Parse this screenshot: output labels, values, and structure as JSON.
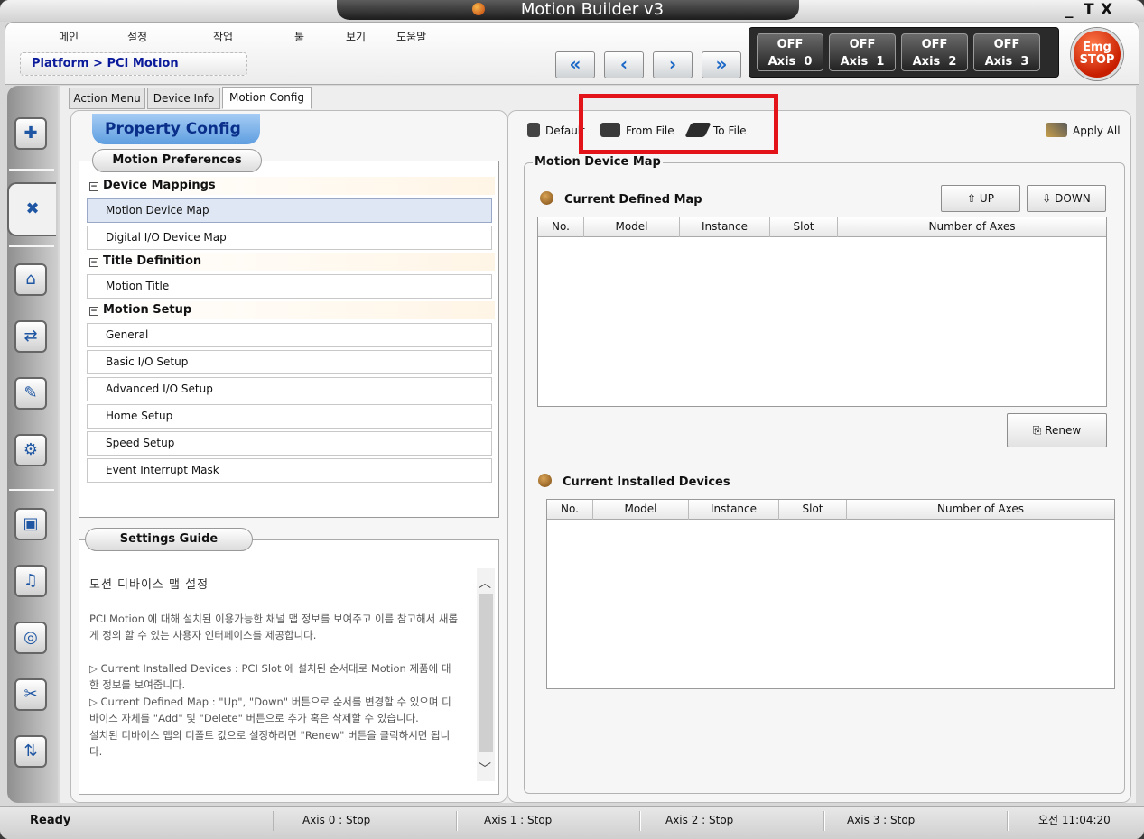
{
  "window": {
    "title": "Motion Builder v3",
    "controls": [
      "_",
      "T",
      "X"
    ]
  },
  "menu": [
    "메인",
    "설정",
    "작업",
    "툴",
    "보기",
    "도움말"
  ],
  "breadcrumb": "Platform > PCI Motion",
  "nav": {
    "first": "«",
    "prev": "‹",
    "next": "›",
    "last": "»"
  },
  "axes": [
    {
      "state": "OFF",
      "label": "Axis",
      "num": "0"
    },
    {
      "state": "OFF",
      "label": "Axis",
      "num": "1"
    },
    {
      "state": "OFF",
      "label": "Axis",
      "num": "2"
    },
    {
      "state": "OFF",
      "label": "Axis",
      "num": "3"
    }
  ],
  "emergency": {
    "line1": "Emg",
    "line2": "STOP"
  },
  "tabs": [
    "Action Menu",
    "Device Info",
    "Motion Config"
  ],
  "left": {
    "header": "Property Config",
    "prefs_title": "Motion Preferences",
    "sections": [
      {
        "title": "Device Mappings",
        "items": [
          "Motion Device Map",
          "Digital I/O Device Map"
        ]
      },
      {
        "title": "Title Definition",
        "items": [
          "Motion Title"
        ]
      },
      {
        "title": "Motion Setup",
        "items": [
          "General",
          "Basic I/O Setup",
          "Advanced I/O Setup",
          "Home Setup",
          "Speed Setup",
          "Event Interrupt Mask"
        ]
      }
    ],
    "guide_title": "Settings Guide",
    "guide": {
      "heading": "모션 디바이스 맵 설정",
      "para1": "PCI Motion 에 대해 설치된 이용가능한 채널 맵 정보를 보여주고 이름 참고해서 새롭게 정의 할 수 있는 사용자 인터페이스를 제공합니다.",
      "para2": "▷ Current Installed Devices : PCI Slot 에 설치된 순서대로 Motion 제품에 대한 정보를 보여줍니다.",
      "para3": "▷ Current Defined Map : \"Up\", \"Down\" 버튼으로 순서를 변경할 수 있으며 디바이스 자체를 \"Add\" 및 \"Delete\" 버튼으로 추가 혹은 삭제할 수 있습니다.",
      "para4": "설치된 디바이스 맵의 디폴트 값으로 설정하려면 \"Renew\" 버튼을 클릭하시면 됩니다."
    }
  },
  "right": {
    "toolbar": {
      "default": "Default",
      "from_file": "From File",
      "to_file": "To File",
      "apply_all": "Apply All"
    },
    "group_title": "Motion Device Map",
    "defined_title": "Current Defined Map",
    "up": "UP",
    "down": "DOWN",
    "renew": "Renew",
    "installed_title": "Current Installed Devices",
    "columns": [
      "No.",
      "Model",
      "Instance",
      "Slot",
      "Number of Axes"
    ]
  },
  "status": {
    "ready": "Ready",
    "axis0": "Axis 0 :  Stop",
    "axis1": "Axis 1 :  Stop",
    "axis2": "Axis 2 :  Stop",
    "axis3": "Axis 3 :  Stop",
    "time": "오전 11:04:20"
  },
  "colors": {
    "highlight": "#e2141a",
    "accent": "#1a67c7",
    "breadcrumb": "#0a1a9a"
  }
}
